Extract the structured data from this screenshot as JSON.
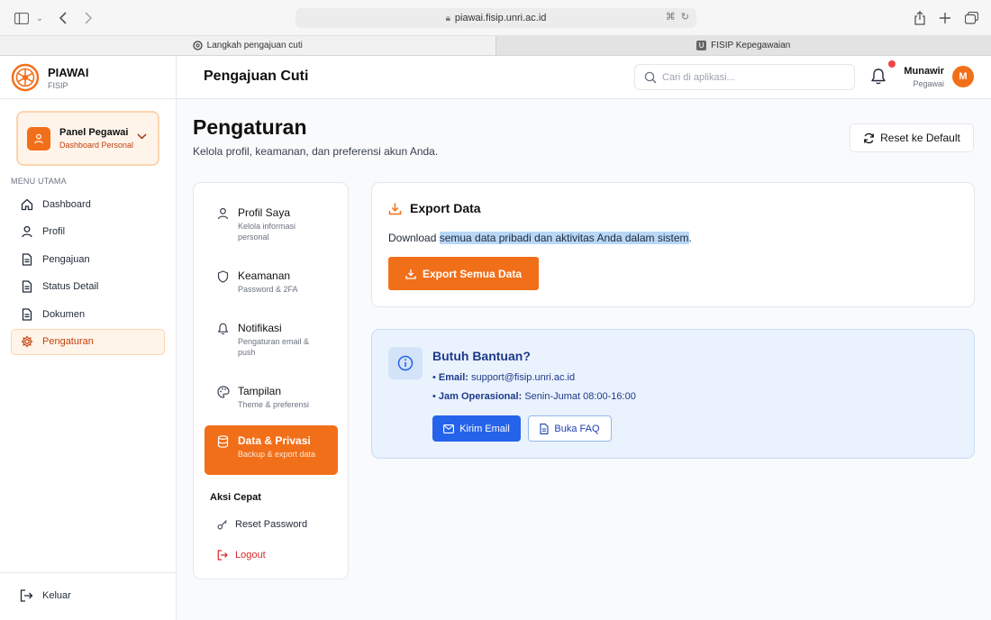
{
  "browser": {
    "url": "piawai.fisip.unri.ac.id",
    "tabs": [
      {
        "label": "Langkah pengajuan cuti"
      },
      {
        "label": "FISIP Kepegawaian"
      }
    ]
  },
  "brand": {
    "name": "PIAWAI",
    "sub": "FISIP"
  },
  "panel": {
    "title": "Panel Pegawai",
    "subtitle": "Dashboard Personal"
  },
  "sidebar": {
    "menu_label": "MENU UTAMA",
    "items": [
      {
        "label": "Dashboard",
        "icon": "home-icon"
      },
      {
        "label": "Profil",
        "icon": "user-icon"
      },
      {
        "label": "Pengajuan",
        "icon": "document-icon"
      },
      {
        "label": "Status Detail",
        "icon": "document-icon"
      },
      {
        "label": "Dokumen",
        "icon": "document-icon"
      },
      {
        "label": "Pengaturan",
        "icon": "gear-icon",
        "active": true
      }
    ],
    "logout_label": "Keluar"
  },
  "header": {
    "title": "Pengajuan Cuti",
    "search_placeholder": "Cari di aplikasi...",
    "user_name": "Munawir",
    "user_role": "Pegawai",
    "avatar_initial": "M"
  },
  "page": {
    "title": "Pengaturan",
    "subtitle": "Kelola profil, keamanan, dan preferensi akun Anda.",
    "reset_label": "Reset ke Default"
  },
  "settings_nav": {
    "items": [
      {
        "title": "Profil Saya",
        "sub": "Kelola informasi personal",
        "icon": "user-icon"
      },
      {
        "title": "Keamanan",
        "sub": "Password & 2FA",
        "icon": "shield-icon"
      },
      {
        "title": "Notifikasi",
        "sub": "Pengaturan email & push",
        "icon": "bell-icon"
      },
      {
        "title": "Tampilan",
        "sub": "Theme & preferensi",
        "icon": "palette-icon"
      },
      {
        "title": "Data & Privasi",
        "sub": "Backup & export data",
        "icon": "database-icon",
        "active": true
      }
    ],
    "quick_title": "Aksi Cepat",
    "quick_reset": "Reset Password",
    "quick_logout": "Logout"
  },
  "export": {
    "title": "Export Data",
    "desc_prefix": "Download ",
    "desc_highlight": "semua data pribadi dan aktivitas Anda dalam sistem",
    "desc_suffix": ".",
    "button": "Export Semua Data"
  },
  "help": {
    "title": "Butuh Bantuan?",
    "email_label": "Email:",
    "email_value": "support@fisip.unri.ac.id",
    "hours_label": "Jam Operasional:",
    "hours_value": "Senin-Jumat 08:00-16:00",
    "email_button": "Kirim Email",
    "faq_button": "Buka FAQ"
  },
  "colors": {
    "accent": "#f26f1a",
    "info_blue": "#2563eb"
  }
}
